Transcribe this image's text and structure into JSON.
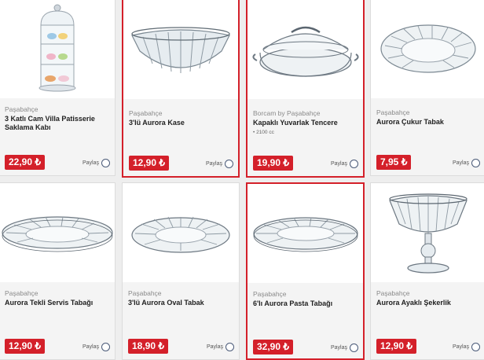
{
  "share_label": "Paylaş",
  "products": [
    {
      "brand": "Paşabahçe",
      "title": "3 Katlı Cam Villa Patisserie Saklama Kabı",
      "subtitle": "",
      "price": "22,90 ₺",
      "image_icon": "patisserie-jar-image"
    },
    {
      "brand": "Paşabahçe",
      "title": "3'lü Aurora Kase",
      "subtitle": "",
      "price": "12,90 ₺",
      "image_icon": "glass-bowl-image"
    },
    {
      "brand": "Borcam by Paşabahçe",
      "title": "Kapaklı Yuvarlak Tencere",
      "subtitle": "• 2100 cc",
      "price": "19,90 ₺",
      "image_icon": "glass-casserole-image"
    },
    {
      "brand": "Paşabahçe",
      "title": "Aurora Çukur Tabak",
      "subtitle": "",
      "price": "7,95 ₺",
      "image_icon": "deep-plate-image"
    },
    {
      "brand": "Paşabahçe",
      "title": "Aurora Tekli Servis Tabağı",
      "subtitle": "",
      "price": "12,90 ₺",
      "image_icon": "serving-plate-image"
    },
    {
      "brand": "Paşabahçe",
      "title": "3'lü Aurora Oval Tabak",
      "subtitle": "",
      "price": "18,90 ₺",
      "image_icon": "oval-plate-image"
    },
    {
      "brand": "Paşabahçe",
      "title": "6'lı Aurora Pasta Tabağı",
      "subtitle": "",
      "price": "32,90 ₺",
      "image_icon": "cake-plate-image"
    },
    {
      "brand": "Paşabahçe",
      "title": "Aurora Ayaklı Şekerlik",
      "subtitle": "",
      "price": "12,90 ₺",
      "image_icon": "footed-candy-bowl-image"
    }
  ],
  "colors": {
    "price_bg": "#d4202a",
    "selected_border": "#d4202a"
  }
}
